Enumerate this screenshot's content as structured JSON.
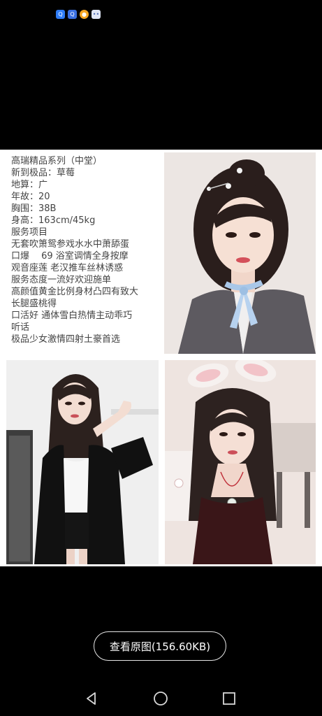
{
  "status_bar": {
    "icons": [
      {
        "name": "app-notification-icon-1",
        "glyph": "Q"
      },
      {
        "name": "app-notification-icon-2",
        "glyph": "Q"
      },
      {
        "name": "browser-icon",
        "glyph": "●"
      },
      {
        "name": "chat-icon",
        "glyph": "••"
      }
    ]
  },
  "poster": {
    "lines": [
      "高瑞精品系列（中堂）",
      "新到极品：草莓",
      "地算：广",
      "年故：20",
      "胸围：38B",
      "身高：163cm/45kg",
      "服务项目",
      "无套吹箫鸳参戏水水中萧舔蛋",
      "口爆　 69 浴室调情全身按摩",
      "观音座莲 老汉推车丝林诱惑",
      "服务态度一流好欢迎施单",
      "高颜值黄金比例身材凸四有致大",
      "长腿盛桃得",
      "口活好 通体雪白热情主动乖巧",
      "听话",
      "极品少女激情四射土豪首选"
    ]
  },
  "view_original_button": {
    "label": "查看原图(156.60KB)"
  },
  "colors": {
    "background": "#000000",
    "poster_background": "#ffffff",
    "poster_text": "#444444",
    "button_border": "#e6e6e6",
    "button_text": "#ffffff"
  }
}
